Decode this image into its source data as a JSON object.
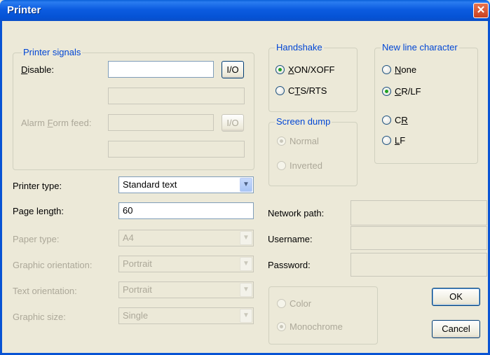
{
  "window": {
    "title": "Printer",
    "close_label": "✕"
  },
  "printer_signals": {
    "legend": "Printer signals",
    "disable_label_pre": "",
    "disable_label_ul": "D",
    "disable_label_post": "isable:",
    "disable_value": "",
    "io_label": "I/O",
    "extra_value": "",
    "alarm_label_pre": "Alarm ",
    "alarm_label_ul": "F",
    "alarm_label_post": "orm feed:",
    "alarm_value": "",
    "alarm_extra_value": ""
  },
  "handshake": {
    "legend": "Handshake",
    "options": [
      {
        "pre": "",
        "ul": "X",
        "post": "ON/XOFF",
        "selected": true
      },
      {
        "pre": "C",
        "ul": "T",
        "post": "S/RTS",
        "selected": false
      }
    ]
  },
  "screen_dump": {
    "legend": "Screen dump",
    "options": [
      {
        "label": "Normal",
        "selected": true
      },
      {
        "label": "Inverted",
        "selected": false
      }
    ]
  },
  "new_line": {
    "legend": "New line character",
    "options": [
      {
        "pre": "",
        "ul": "N",
        "post": "one",
        "selected": false
      },
      {
        "pre": "",
        "ul": "C",
        "post": "R/LF",
        "selected": true
      },
      {
        "pre": "C",
        "ul": "R",
        "post": "",
        "selected": false
      },
      {
        "pre": "",
        "ul": "L",
        "post": "F",
        "selected": false
      }
    ]
  },
  "form": {
    "printer_type_label": "Printer type:",
    "printer_type_value": "Standard text",
    "page_length_label": "Page length:",
    "page_length_value": "60",
    "paper_type_label": "Paper type:",
    "paper_type_value": "A4",
    "graphic_orientation_label": "Graphic orientation:",
    "graphic_orientation_value": "Portrait",
    "text_orientation_label": "Text orientation:",
    "text_orientation_value": "Portrait",
    "graphic_size_label": "Graphic size:",
    "graphic_size_value": "Single"
  },
  "network": {
    "path_label": "Network path:",
    "path_value": "",
    "username_label": "Username:",
    "username_value": "",
    "password_label": "Password:",
    "password_value": ""
  },
  "color_mode": {
    "options": [
      {
        "label": "Color",
        "selected": false
      },
      {
        "label": "Monochrome",
        "selected": true
      }
    ]
  },
  "buttons": {
    "ok": "OK",
    "cancel": "Cancel"
  },
  "icons": {
    "dropdown": "chevron-down-icon",
    "close": "close-icon"
  }
}
